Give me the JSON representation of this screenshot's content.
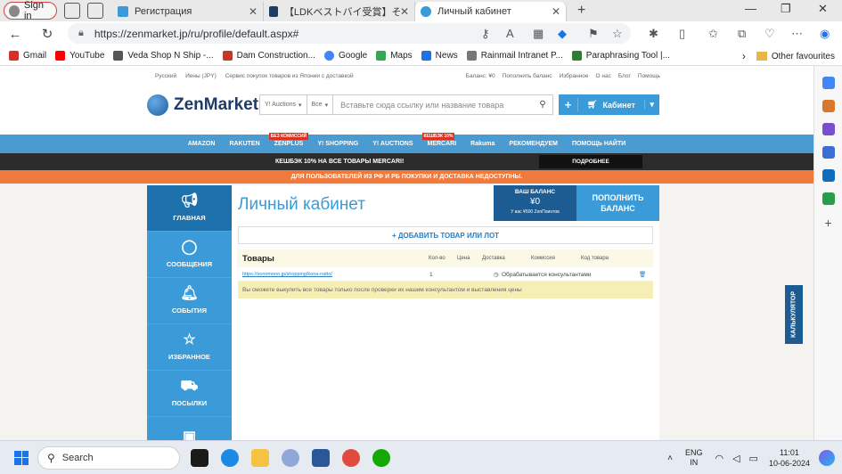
{
  "browser": {
    "signin_label": "Sign in",
    "tabs": [
      {
        "label": "Регистрация",
        "color": "#3a9bd8"
      },
      {
        "label": "【LDKベストバイ受賞】そのもの「こな",
        "color": "#1e3d66"
      },
      {
        "label": "Личный кабинет",
        "color": "#3a9bd8"
      }
    ],
    "url": "https://zenmarket.jp/ru/profile/default.aspx#",
    "bookmarks": [
      {
        "label": "Gmail",
        "color": "#d93025"
      },
      {
        "label": "YouTube",
        "color": "#ff0000"
      },
      {
        "label": "Veda Shop N Ship -...",
        "color": "#555555"
      },
      {
        "label": "Dam Construction...",
        "color": "#c0392b"
      },
      {
        "label": "Google",
        "color": "#4285f4"
      },
      {
        "label": "Maps",
        "color": "#34a853"
      },
      {
        "label": "News",
        "color": "#1a73e8"
      },
      {
        "label": "Rainmail Intranet P...",
        "color": "#777777"
      },
      {
        "label": "Paraphrasing Tool |...",
        "color": "#2e7d32"
      }
    ],
    "other_favourites": "Other favourites"
  },
  "site": {
    "topstrip_left": [
      "Русский",
      "Иены (JPY)",
      "Сервис покупок товаров из Японии с доставкой"
    ],
    "topstrip_right": [
      "Баланс: ¥0",
      "Пополнить баланс",
      "Избранное",
      "О нас",
      "Блог",
      "Помощь"
    ],
    "logo": "ZenMarket",
    "search": {
      "source": "Y! Auctions",
      "category": "Все",
      "placeholder": "Вставьте сюда ссылку или название товара"
    },
    "cabinet_button": "Кабинет",
    "menu": [
      {
        "label": "AMAZON",
        "badge": ""
      },
      {
        "label": "RAKUTEN",
        "badge": ""
      },
      {
        "label": "ZENPLUS",
        "badge": "БЕЗ КОМИССИЙ"
      },
      {
        "label": "Y! SHOPPING",
        "badge": ""
      },
      {
        "label": "Y! AUCTIONS",
        "badge": ""
      },
      {
        "label": "MERCARI",
        "badge": "КЕШБЭК 10%"
      },
      {
        "label": "Rakuma",
        "badge": ""
      },
      {
        "label": "РЕКОМЕНДУЕМ",
        "badge": ""
      },
      {
        "label": "ПОМОЩЬ НАЙТИ",
        "badge": ""
      }
    ],
    "cashback_text": "КЕШБЭК 10% НА ВСЕ ТОВАРЫ MERCARI!",
    "cashback_more": "ПОДРОБНЕЕ",
    "notice_text": "ДЛЯ ПОЛЬЗОВАТЕЛЕЙ ИЗ РФ И РБ ПОКУПКИ И ДОСТАВКА НЕДОСТУПНЫ."
  },
  "sidenav": [
    {
      "label": "ГЛАВНАЯ",
      "icon": "megaphone-icon"
    },
    {
      "label": "СООБЩЕНИЯ",
      "icon": "chat-icon"
    },
    {
      "label": "СОБЫТИЯ",
      "icon": "bell-icon"
    },
    {
      "label": "ИЗБРАННОЕ",
      "icon": "star-icon"
    },
    {
      "label": "ПОСЫЛКИ",
      "icon": "truck-icon"
    },
    {
      "label": "",
      "icon": "wallet-icon"
    }
  ],
  "main": {
    "title": "Личный кабинет",
    "balance_label": "ВАШ БАЛАНС",
    "balance_value": "¥0",
    "points_text": "У вас ¥500 ZenПоинтов",
    "topup_line1": "ПОПОЛНИТЬ",
    "topup_line2": "БАЛАНС",
    "add_button": "+ ДОБАВИТЬ ТОВАР ИЛИ ЛОТ",
    "goods_title": "Товары",
    "columns": [
      "Кол-во",
      "Цена",
      "Доставка",
      "Комиссия",
      "Код товара"
    ],
    "row": {
      "link": "https://sonomono.jp/shopping/kona-natto/",
      "qty": "1",
      "status": "Обрабатывается консультантами"
    },
    "note": "Вы сможете выкупить все товары только после проверки их нашим консультантом и выставления цены"
  },
  "calculator_tab": "КАЛЬКУЛЯТОР",
  "taskbar": {
    "search_placeholder": "Search",
    "lang_line1": "ENG",
    "lang_line2": "IN",
    "time": "11:01",
    "date": "10-06-2024"
  }
}
